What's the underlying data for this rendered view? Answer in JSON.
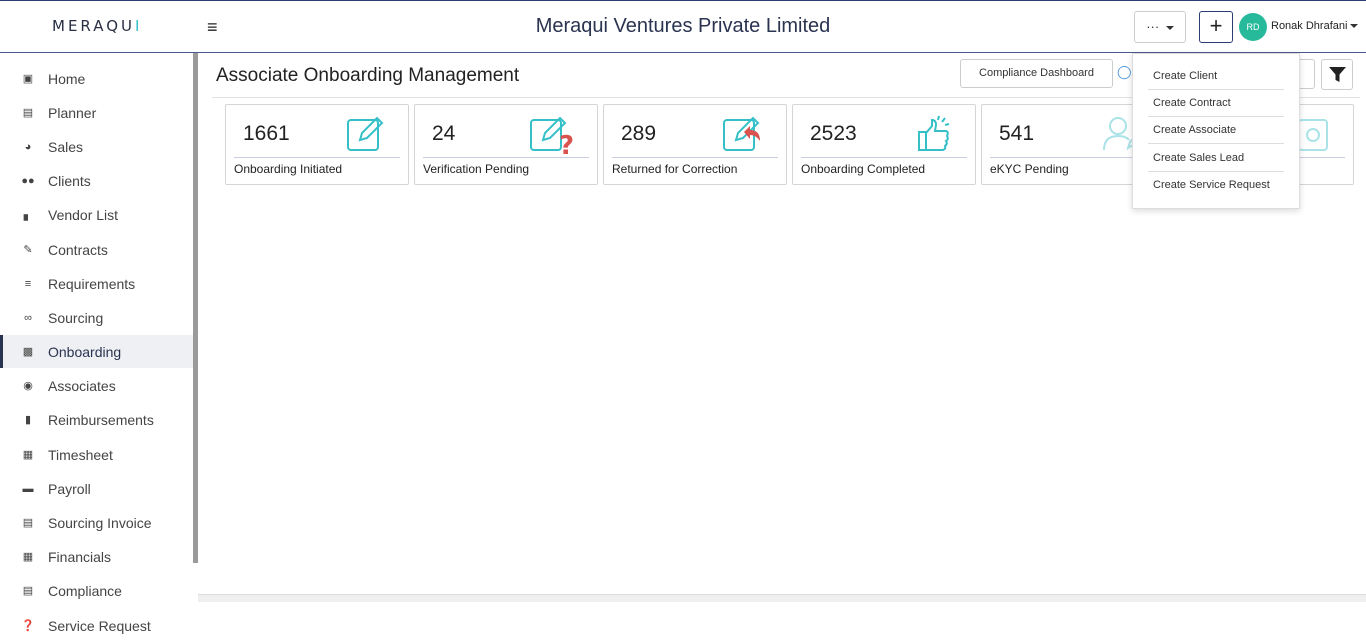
{
  "header": {
    "logo": "MERAQUI",
    "company_name": "Meraqui Ventures Private Limited",
    "more_label": "···",
    "plus_label": "+",
    "avatar_initials": "RD",
    "user_name": "Ronak Dhrafani"
  },
  "sidebar": {
    "items": [
      {
        "label": "Home",
        "icon": "home-icon"
      },
      {
        "label": "Planner",
        "icon": "clipboard-icon"
      },
      {
        "label": "Sales",
        "icon": "pie-chart-icon"
      },
      {
        "label": "Clients",
        "icon": "users-icon"
      },
      {
        "label": "Vendor List",
        "icon": "industry-icon"
      },
      {
        "label": "Contracts",
        "icon": "file-signature-icon"
      },
      {
        "label": "Requirements",
        "icon": "list-check-icon"
      },
      {
        "label": "Sourcing",
        "icon": "fingerprint-icon"
      },
      {
        "label": "Onboarding",
        "icon": "onboarding-icon",
        "active": true
      },
      {
        "label": "Associates",
        "icon": "headset-icon"
      },
      {
        "label": "Reimbursements",
        "icon": "briefcase-money-icon"
      },
      {
        "label": "Timesheet",
        "icon": "calendar-icon"
      },
      {
        "label": "Payroll",
        "icon": "credit-card-icon"
      },
      {
        "label": "Sourcing Invoice",
        "icon": "invoice-icon"
      },
      {
        "label": "Financials",
        "icon": "calculator-icon"
      },
      {
        "label": "Compliance",
        "icon": "clipboard-check-icon"
      },
      {
        "label": "Service Request",
        "icon": "question-circle-icon"
      }
    ]
  },
  "main": {
    "title": "Associate Onboarding Management",
    "compliance_dashboard_label": "Compliance Dashboard",
    "cards": [
      {
        "value": "1661",
        "label": "Onboarding Initiated",
        "icon": "edit-icon"
      },
      {
        "value": "24",
        "label": "Verification Pending",
        "icon": "edit-question-icon"
      },
      {
        "value": "289",
        "label": "Returned for Correction",
        "icon": "edit-return-icon"
      },
      {
        "value": "2523",
        "label": "Onboarding Completed",
        "icon": "thumbs-up-icon"
      },
      {
        "value": "541",
        "label": "eKYC Pending",
        "icon": "user-edit-icon"
      }
    ]
  },
  "create_menu": {
    "items": [
      "Create Client",
      "Create Contract",
      "Create Associate",
      "Create Sales Lead",
      "Create Service Request"
    ]
  },
  "colors": {
    "brand_dark": "#2a3350",
    "accent_teal": "#35c0c8",
    "avatar_green": "#26b99a",
    "question_red": "#d9534f"
  }
}
